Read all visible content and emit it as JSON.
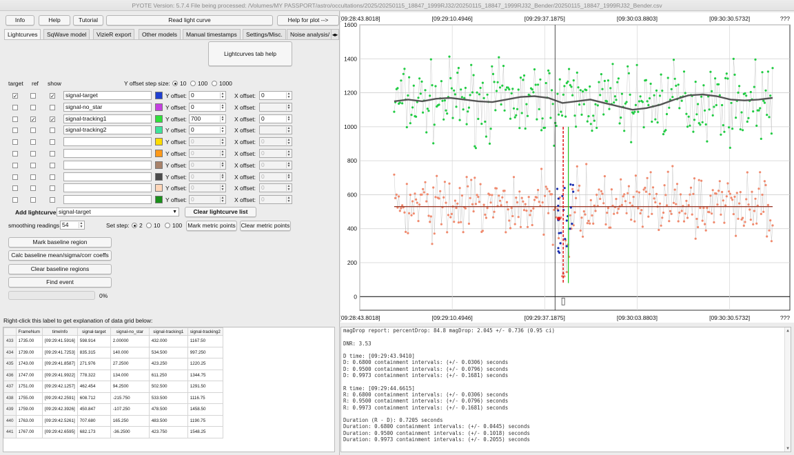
{
  "window": {
    "title": "PYOTE Version: 5.7.4  File being processed: /Volumes/MY PASSPORT/astro/occultations/2025/20250115_18847_1999RJ32/20250115_18847_1999RJ32_Bender/20250115_18847_1999RJ32_Bender.csv"
  },
  "toolbar": {
    "info": "Info",
    "help": "Help",
    "tutorial": "Tutorial",
    "read_light_curve": "Read light curve",
    "help_for_plot": "Help for plot -->"
  },
  "tabs": [
    "Lightcurves",
    "SqWave model",
    "VizieR export",
    "Other models",
    "Manual timestamps",
    "Settings/Misc.",
    "Noise analysis/"
  ],
  "lightcurves_tab_help": "Lightcurves tab help",
  "headers": {
    "target": "target",
    "ref": "ref",
    "show": "show"
  },
  "y_offset_step": {
    "label": "Y offset step size:",
    "options": [
      "10",
      "100",
      "1000"
    ],
    "selected": "10"
  },
  "rows": [
    {
      "target": true,
      "ref": false,
      "show": true,
      "name": "signal-target",
      "color": "#1f3fd0",
      "y_offset": "0",
      "x_offset": "0",
      "enabled": true
    },
    {
      "target": false,
      "ref": false,
      "show": false,
      "name": "signal-no_star",
      "color": "#c43fe0",
      "y_offset": "0",
      "x_offset": "",
      "enabled": true
    },
    {
      "target": false,
      "ref": true,
      "show": true,
      "name": "signal-tracking1",
      "color": "#2fe03a",
      "y_offset": "700",
      "x_offset": "0",
      "enabled": true
    },
    {
      "target": false,
      "ref": false,
      "show": false,
      "name": "signal-tracking2",
      "color": "#3fe39a",
      "y_offset": "0",
      "x_offset": "",
      "enabled": true
    },
    {
      "target": false,
      "ref": false,
      "show": false,
      "name": "",
      "color": "#ffdc00",
      "y_offset": "0",
      "x_offset": "0",
      "enabled": false
    },
    {
      "target": false,
      "ref": false,
      "show": false,
      "name": "",
      "color": "#ff9a1a",
      "y_offset": "0",
      "x_offset": "0",
      "enabled": false
    },
    {
      "target": false,
      "ref": false,
      "show": false,
      "name": "",
      "color": "#a8826a",
      "y_offset": "0",
      "x_offset": "0",
      "enabled": false
    },
    {
      "target": false,
      "ref": false,
      "show": false,
      "name": "",
      "color": "#4a4a4a",
      "y_offset": "0",
      "x_offset": "0",
      "enabled": false
    },
    {
      "target": false,
      "ref": false,
      "show": false,
      "name": "",
      "color": "#ffd6b8",
      "y_offset": "0",
      "x_offset": "0",
      "enabled": false
    },
    {
      "target": false,
      "ref": false,
      "show": false,
      "name": "",
      "color": "#1a8f1a",
      "y_offset": "0",
      "x_offset": "0",
      "enabled": false
    }
  ],
  "y_offset_label": "Y offset:",
  "x_offset_label": "X offset:",
  "add_lightcurve": {
    "label": "Add lightcurve",
    "value": "signal-target"
  },
  "clear_lightcurve_list": "Clear lightcurve list",
  "smoothing": {
    "label": "smoothing readings",
    "value": "54"
  },
  "set_step": {
    "label": "Set step:",
    "options": [
      "2",
      "10",
      "100"
    ],
    "selected": "2"
  },
  "mark_metric_points": "Mark metric points",
  "clear_metric_points": "Clear metric points",
  "mark_baseline_region": "Mark baseline region",
  "calc_baseline": "Calc baseline mean/sigma/corr coeffs",
  "clear_baseline_regions": "Clear baseline regions",
  "find_event": "Find event",
  "progress": {
    "value": 0,
    "label": "0%"
  },
  "right_click_label": "Right-click this label to get explanation of data grid below:",
  "grid": {
    "columns": [
      "FrameNum",
      "timeInfo",
      "signal-target",
      "signal-no_star",
      "signal-tracking1",
      "signal-tracking2"
    ],
    "rows": [
      [
        "433",
        "1735.00",
        "[09:29:41.5916]",
        "598.914",
        "2.00000",
        "432.000",
        "1167.50"
      ],
      [
        "434",
        "1739.00",
        "[09:29:41.7253]",
        "835.315",
        "140.000",
        "534.500",
        "997.250"
      ],
      [
        "435",
        "1743.00",
        "[09:29:41.8587]",
        "271.976",
        "27.2500",
        "423.250",
        "1220.25"
      ],
      [
        "436",
        "1747.00",
        "[09:29:41.9922]",
        "778.322",
        "134.000",
        "611.250",
        "1344.75"
      ],
      [
        "437",
        "1751.00",
        "[09:29:42.1257]",
        "462.454",
        "94.2500",
        "502.500",
        "1291.50"
      ],
      [
        "438",
        "1755.00",
        "[09:29:42.2591]",
        "608.712",
        "-215.750",
        "533.500",
        "1116.75"
      ],
      [
        "439",
        "1759.00",
        "[09:29:42.3926]",
        "450.847",
        "-107.250",
        "478.500",
        "1458.50"
      ],
      [
        "440",
        "1763.00",
        "[09:29:42.5261]",
        "707.680",
        "165.250",
        "483.500",
        "1190.75"
      ],
      [
        "441",
        "1767.00",
        "[09:29:42.6595]",
        "682.173",
        "-36.2500",
        "423.750",
        "1548.25"
      ]
    ]
  },
  "report_lines": [
    "magDrop report: percentDrop: 84.8 magDrop: 2.045 +/- 0.736 (0.95 ci)",
    "",
    "DNR: 3.53",
    "",
    "D time: [09:29:43.9410]",
    "D: 0.6800 containment intervals: (+/- 0.0306) seconds",
    "D: 0.9500 containment intervals: (+/- 0.0796) seconds",
    "D: 0.9973 containment intervals: (+/- 0.1681) seconds",
    "",
    "R time: [09:29:44.6615]",
    "R: 0.6800 containment intervals: (+/- 0.0306) seconds",
    "R: 0.9500 containment intervals: (+/- 0.0796) seconds",
    "R: 0.9973 containment intervals: (+/- 0.1681) seconds",
    "",
    "Duration (R - D): 0.7205 seconds",
    "Duration: 0.6800 containment intervals: (+/- 0.0445) seconds",
    "Duration: 0.9500 containment intervals: (+/- 0.1018) seconds",
    "Duration: 0.9973 containment intervals: (+/- 0.2055) seconds"
  ],
  "chart_data": {
    "type": "scatter",
    "ylim": [
      -80,
      1600
    ],
    "xlim": [
      0,
      100
    ],
    "yticks": [
      "0",
      "200",
      "400",
      "600",
      "800",
      "1000",
      "1200",
      "1400",
      "1600"
    ],
    "ytick_values": [
      0,
      200,
      400,
      600,
      800,
      1000,
      1200,
      1400,
      1600
    ],
    "xticks": [
      "[09:28:43.8018]",
      "[09:29:10.4946]",
      "[09:29:37.1875]",
      "[09:30:03.8803]",
      "[09:30:30.5732]",
      "???"
    ],
    "xtick_values": [
      0,
      21.5,
      43,
      64.5,
      86,
      100
    ],
    "grid": true,
    "cursor_x": 47.5,
    "series": [
      {
        "color": "#22cc44",
        "mean": 1150,
        "spread": 170,
        "smooth": [
          1150,
          1160,
          1150,
          1165,
          1170,
          1160,
          1150,
          1145,
          1160,
          1175,
          1180,
          1170,
          1140,
          1150,
          1160,
          1140,
          1120,
          1100,
          1110,
          1130,
          1160,
          1185,
          1190,
          1180,
          1160,
          1155,
          1160,
          1170
        ],
        "x_range": [
          8,
          96
        ]
      },
      {
        "color": "#f08a6e",
        "mean": 530,
        "spread": 150,
        "smooth": [
          530,
          530
        ],
        "x_range": [
          8,
          96
        ]
      }
    ],
    "event": {
      "d_x": 47.3,
      "r_x": 48.5,
      "low": 90,
      "high": 1000,
      "bottom": 80
    }
  }
}
